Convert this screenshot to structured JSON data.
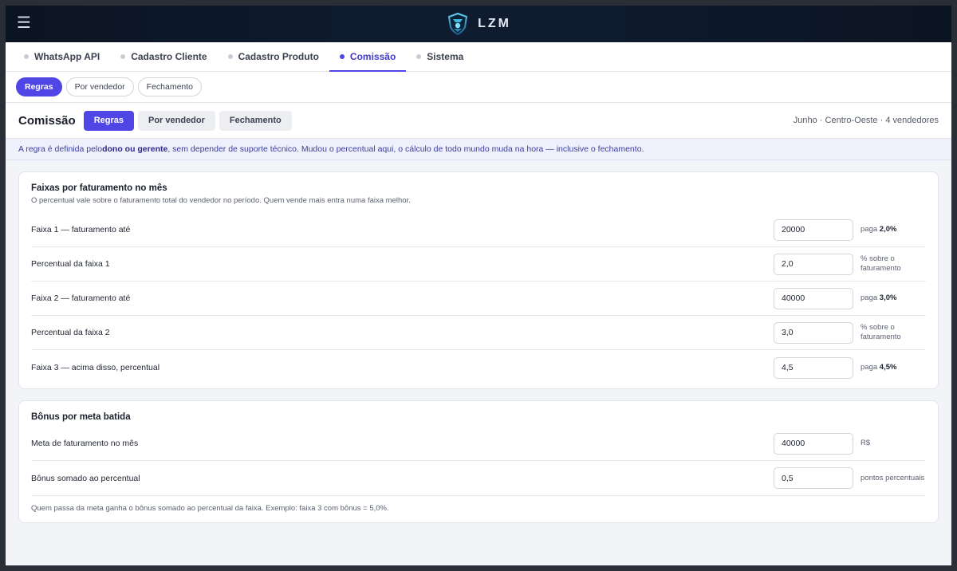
{
  "header": {
    "menu_icon": "hamburger-icon",
    "brand_name": "LZM",
    "logo_icon": "shield-logo-icon"
  },
  "tabs": [
    {
      "label": "WhatsApp API",
      "active": false
    },
    {
      "label": "Cadastro Cliente",
      "active": false
    },
    {
      "label": "Cadastro Produto",
      "active": false
    },
    {
      "label": "Comissão",
      "active": true
    },
    {
      "label": "Sistema",
      "active": false
    }
  ],
  "subpills": [
    {
      "label": "Regras",
      "active": true
    },
    {
      "label": "Por vendedor",
      "active": false
    },
    {
      "label": "Fechamento",
      "active": false
    }
  ],
  "page": {
    "title": "Comissão",
    "segments": [
      {
        "label": "Regras",
        "active": true
      },
      {
        "label": "Por vendedor",
        "active": false
      },
      {
        "label": "Fechamento",
        "active": false
      }
    ],
    "meta": "Junho · Centro-Oeste · 4 vendedores"
  },
  "banner": {
    "pre": "A regra é definida pelo ",
    "bold": "dono ou gerente",
    "post": ", sem depender de suporte técnico. Mudou o percentual aqui, o cálculo de todo mundo muda na hora — inclusive o fechamento."
  },
  "faixas": {
    "title": "Faixas por faturamento no mês",
    "desc": "O percentual vale sobre o faturamento total do vendedor no período. Quem vende mais entra numa faixa melhor.",
    "rows": [
      {
        "label": "Faixa 1 — faturamento até",
        "value": "20000",
        "note_pre": "paga ",
        "note_bold": "2,0%"
      },
      {
        "label": "Percentual da faixa 1",
        "value": "2,0",
        "note_pre": "% sobre o faturamento",
        "note_bold": ""
      },
      {
        "label": "Faixa 2 — faturamento até",
        "value": "40000",
        "note_pre": "paga ",
        "note_bold": "3,0%"
      },
      {
        "label": "Percentual da faixa 2",
        "value": "3,0",
        "note_pre": "% sobre o faturamento",
        "note_bold": ""
      },
      {
        "label": "Faixa 3 — acima disso, percentual",
        "value": "4,5",
        "note_pre": "paga ",
        "note_bold": "4,5%"
      }
    ]
  },
  "bonus": {
    "title": "Bônus por meta batida",
    "rows": [
      {
        "label": "Meta de faturamento no mês",
        "value": "40000",
        "note_pre": "R$",
        "note_bold": ""
      },
      {
        "label": "Bônus somado ao percentual",
        "value": "0,5",
        "note_pre": "pontos percentuais",
        "note_bold": ""
      }
    ],
    "footnote": "Quem passa da meta ganha o bônus somado ao percentual da faixa. Exemplo: faixa 3 com bônus = 5,0%."
  }
}
